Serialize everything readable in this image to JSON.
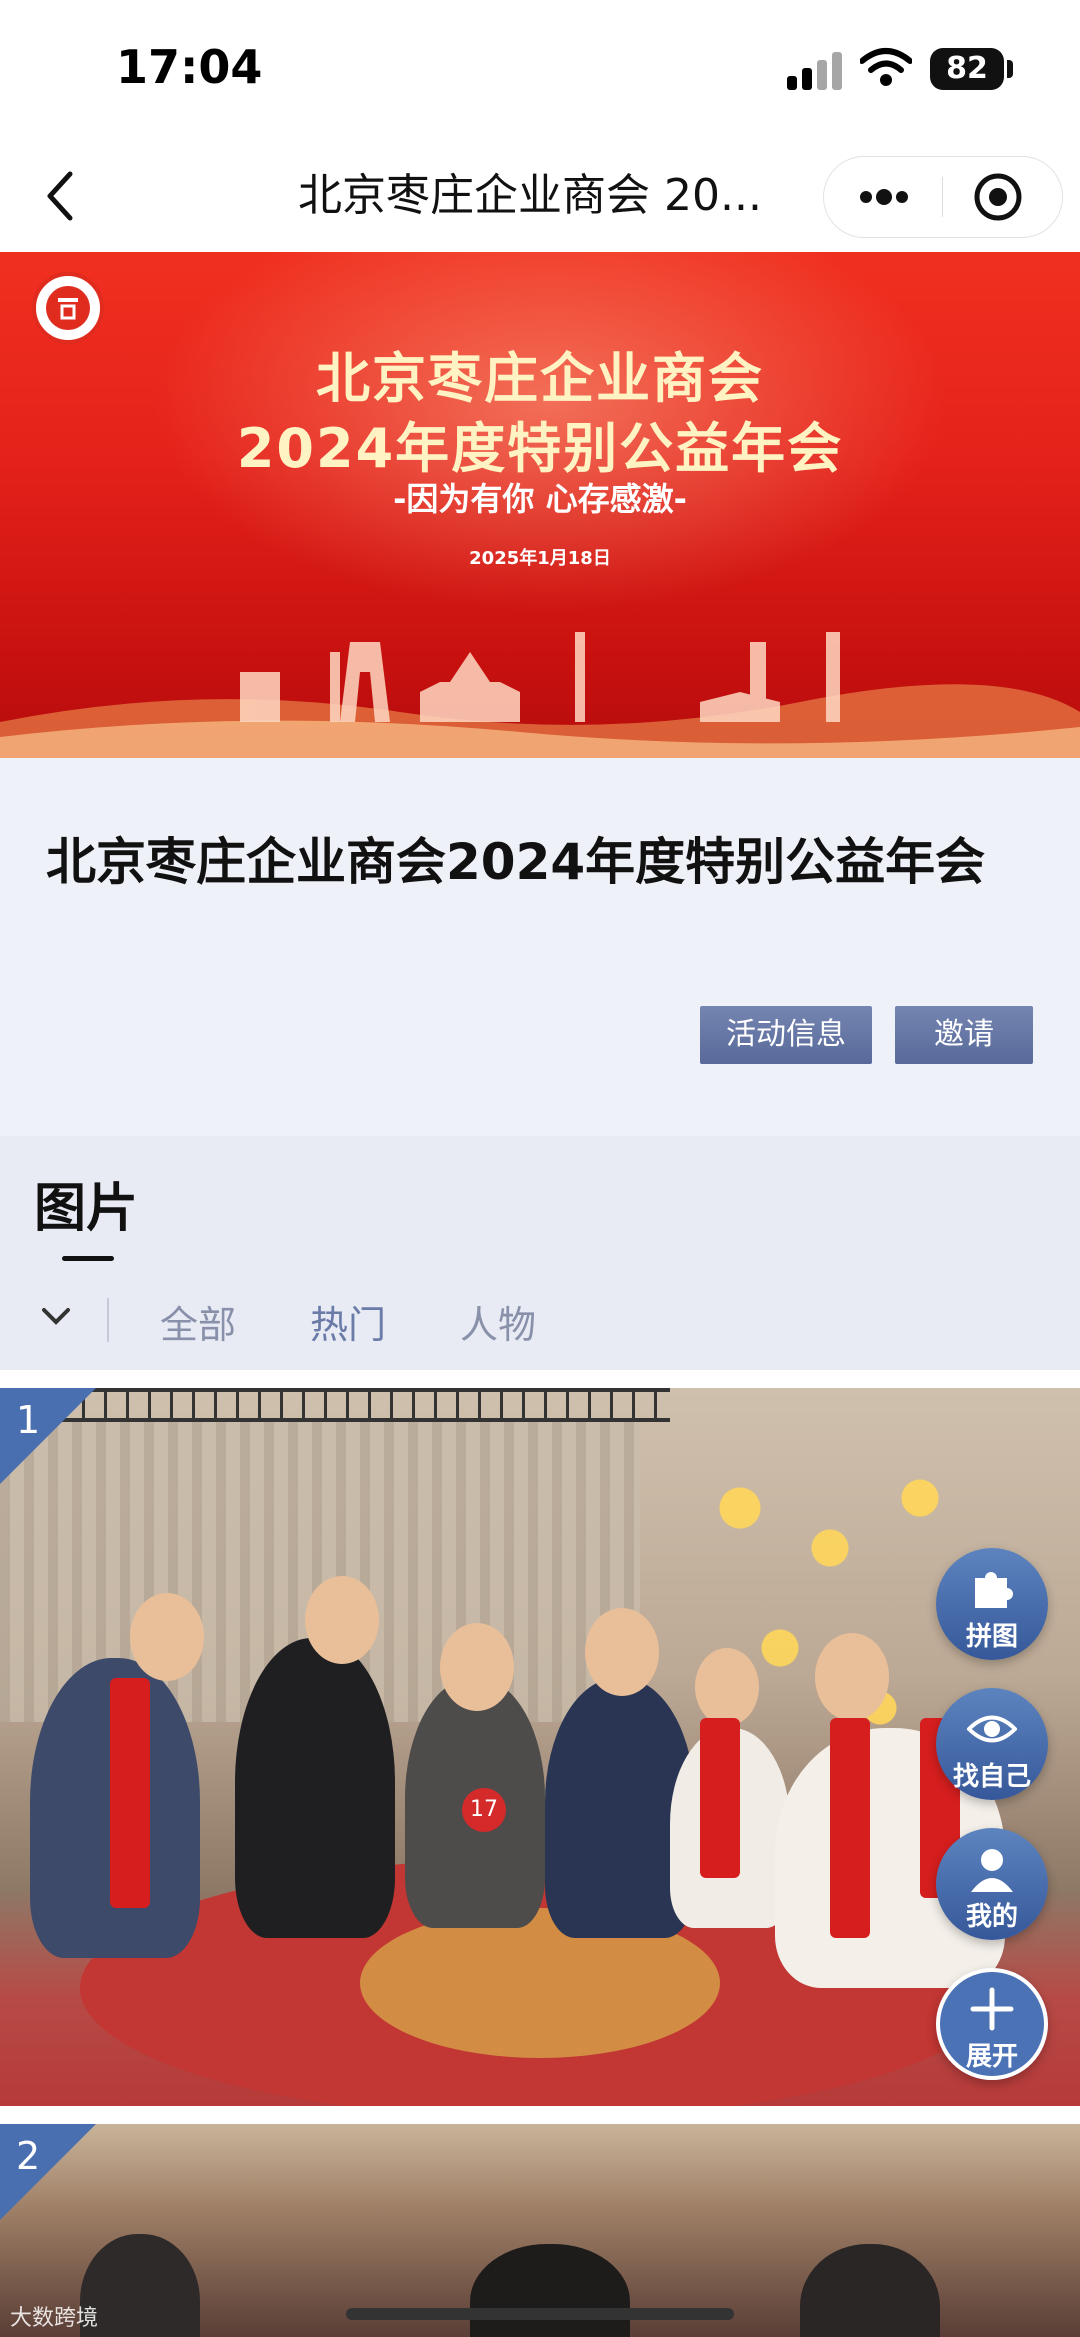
{
  "status_bar": {
    "time": "17:04",
    "battery": "82"
  },
  "nav": {
    "title": "北京枣庄企业商会 20..."
  },
  "banner": {
    "line1": "北京枣庄企业商会",
    "line2": "2024年度特别公益年会",
    "subtitle": "-因为有你  心存感激-",
    "date": "2025年1月18日"
  },
  "event": {
    "title": "北京枣庄企业商会2024年度特别公益年会",
    "buttons": {
      "info": "活动信息",
      "invite": "邀请"
    }
  },
  "photos": {
    "heading": "图片",
    "tabs": [
      {
        "label": "全部"
      },
      {
        "label": "热门"
      },
      {
        "label": "人物"
      }
    ],
    "items": [
      {
        "index": "1",
        "table_card": "17"
      },
      {
        "index": "2"
      }
    ]
  },
  "fabs": {
    "puzzle": "拼图",
    "find_me": "找自己",
    "mine": "我的",
    "expand": "展开"
  },
  "watermark": "大数跨境",
  "colors": {
    "accent": "#586a9a",
    "banner_red": "#e5221b",
    "fab_blue": "#4a72b5"
  }
}
